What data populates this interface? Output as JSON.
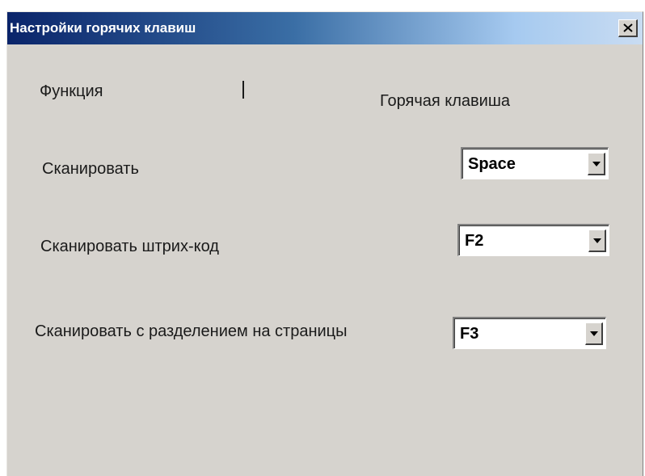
{
  "window": {
    "title": "Настройки горячих клавиш",
    "close_icon": "close-icon"
  },
  "header": {
    "function_label": "Функция",
    "hotkey_label": "Горячая клавиша"
  },
  "rows": [
    {
      "label": "Сканировать",
      "value": "Space"
    },
    {
      "label": "Сканировать штрих-код",
      "value": "F2"
    },
    {
      "label": "Сканировать с разделением на страницы",
      "value": "F3"
    }
  ],
  "colors": {
    "title_gradient_start": "#0a246a",
    "title_gradient_end": "#c9dcf2",
    "dialog_background": "#d6d3ce"
  }
}
